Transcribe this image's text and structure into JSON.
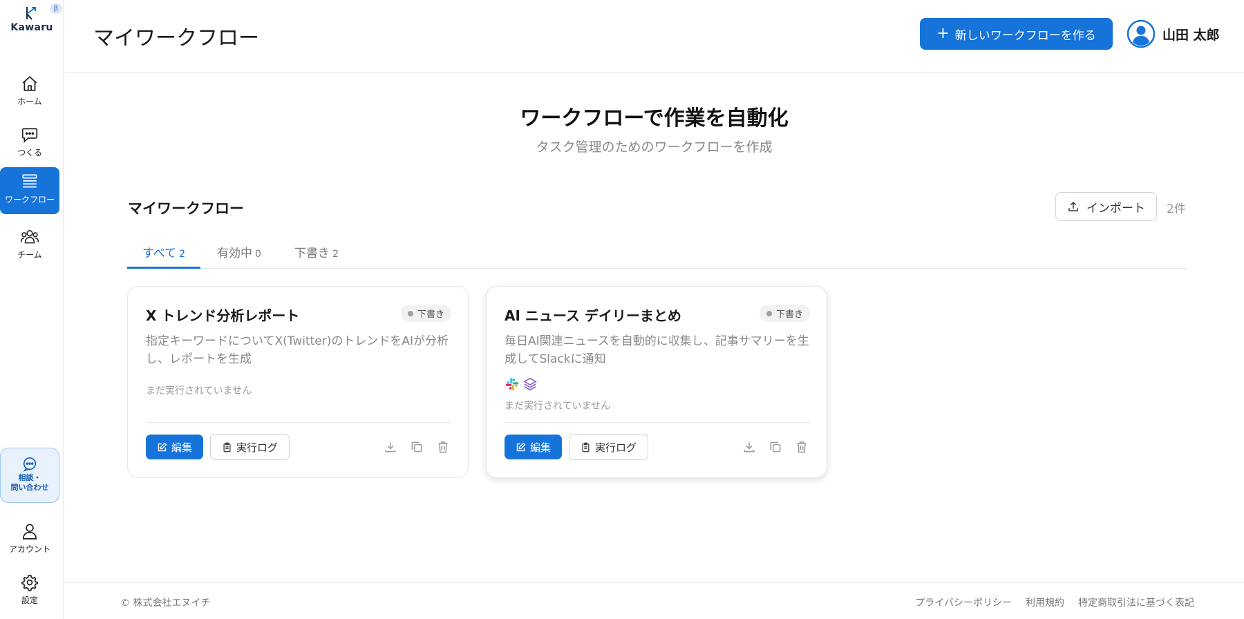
{
  "brand": {
    "name": "Kawaru",
    "beta": "β"
  },
  "sidebar": {
    "items": [
      {
        "label": "ホーム",
        "icon": "home-icon"
      },
      {
        "label": "つくる",
        "icon": "chat-bubble-icon"
      },
      {
        "label": "ワークフロー",
        "icon": "workflow-icon",
        "active": true
      },
      {
        "label": "チーム",
        "icon": "team-icon"
      }
    ],
    "consult": {
      "label_line1": "相談・",
      "label_line2": "問い合わせ",
      "icon": "chat-bubble-icon"
    },
    "account": {
      "label": "アカウント",
      "icon": "user-icon"
    },
    "settings": {
      "label": "設定",
      "icon": "gear-icon"
    }
  },
  "header": {
    "title": "マイワークフロー",
    "new_button": "新しいワークフローを作る",
    "user_name": "山田 太郎"
  },
  "hero": {
    "title": "ワークフローで作業を自動化",
    "subtitle": "タスク管理のためのワークフローを作成"
  },
  "section": {
    "title": "マイワークフロー",
    "import_label": "インポート",
    "count": "2件",
    "tabs": [
      {
        "label": "すべて",
        "count": "2",
        "active": true
      },
      {
        "label": "有効中",
        "count": "0"
      },
      {
        "label": "下書き",
        "count": "2"
      }
    ]
  },
  "cards": [
    {
      "title": "X トレンド分析レポート",
      "badge": "下書き",
      "description": "指定キーワードについてX(Twitter)のトレンドをAIが分析し、レポートを生成",
      "status": "まだ実行されていません",
      "edit_label": "編集",
      "log_label": "実行ログ"
    },
    {
      "title": "AI ニュース デイリーまとめ",
      "badge": "下書き",
      "description": "毎日AI関連ニュースを自動的に収集し、記事サマリーを生成してSlackに通知",
      "status": "まだ実行されていません",
      "edit_label": "編集",
      "log_label": "実行ログ",
      "integrations": [
        "slack-icon",
        "layers-icon"
      ]
    }
  ],
  "footer": {
    "copyright": "© 株式会社エヌイチ",
    "links": [
      "プライバシーポリシー",
      "利用規約",
      "特定商取引法に基づく表記"
    ]
  },
  "colors": {
    "accent": "#1673d9",
    "border": "#e3e6ea",
    "muted": "#888888"
  }
}
